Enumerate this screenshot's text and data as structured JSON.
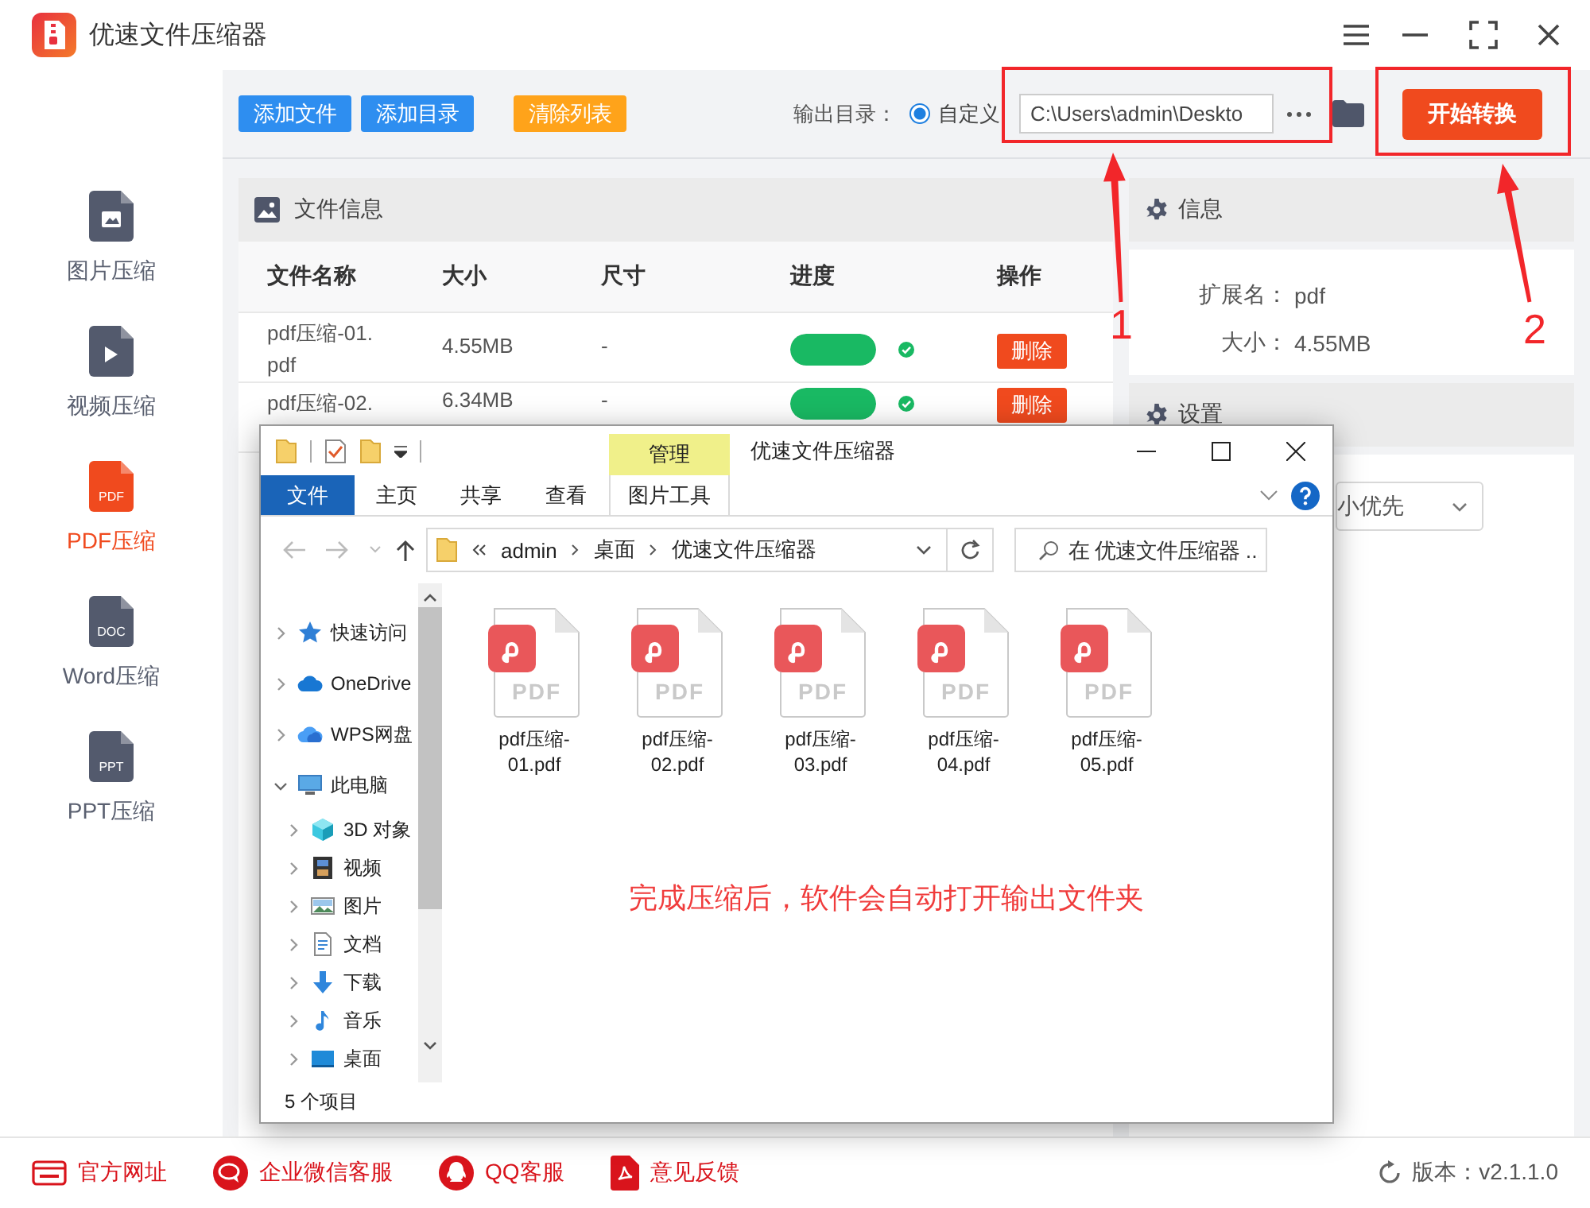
{
  "app": {
    "title": "优速文件压缩器"
  },
  "sidebar": {
    "items": [
      {
        "label": "图片压缩",
        "kind": "image",
        "selected": false
      },
      {
        "label": "视频压缩",
        "kind": "video",
        "selected": false
      },
      {
        "label": "PDF压缩",
        "kind": "badge",
        "icon_text": "PDF",
        "selected": true
      },
      {
        "label": "Word压缩",
        "kind": "badge",
        "icon_text": "DOC",
        "selected": false
      },
      {
        "label": "PPT压缩",
        "kind": "badge",
        "icon_text": "PPT",
        "selected": false
      }
    ]
  },
  "toolbar": {
    "buttons": [
      {
        "label": "添加文件",
        "kind": "primary"
      },
      {
        "label": "添加目录",
        "kind": "primary"
      },
      {
        "label": "清除列表",
        "kind": "warning"
      }
    ],
    "output_label": "输出目录：",
    "radio": {
      "label": "自定义",
      "checked": true
    },
    "path": "C:\\Users\\admin\\Deskto",
    "start": "开始转换"
  },
  "file_panel": {
    "title": "文件信息",
    "columns": [
      "文件名称",
      "大小",
      "尺寸",
      "进度",
      "操作"
    ],
    "rows": [
      {
        "name": "pdf压缩-01.pdf",
        "size": "4.55MB",
        "dims": "-",
        "level": 1,
        "done": true,
        "action": "删除"
      },
      {
        "name": "pdf压缩-02.",
        "size": "6.34MB",
        "dims": "-",
        "level": 1,
        "done": true,
        "action": "删除"
      }
    ]
  },
  "info_panel": {
    "title": "信息",
    "fields": [
      {
        "label": "扩展名：",
        "value": "pdf"
      },
      {
        "label": "大小：",
        "value": "4.55MB"
      }
    ]
  },
  "settings_panel": {
    "title": "设置",
    "select_value": "小优先"
  },
  "footer": {
    "links": [
      {
        "label": "官方网址",
        "kind": "web"
      },
      {
        "label": "企业微信客服",
        "kind": "wechat"
      },
      {
        "label": "QQ客服",
        "kind": "qq"
      },
      {
        "label": "意见反馈",
        "kind": "feedback"
      }
    ],
    "version": "版本：v2.1.1.0"
  },
  "explorer": {
    "title": "优速文件压缩器",
    "context_label": "管理",
    "tabs": [
      {
        "label": "文件",
        "kind": "file"
      },
      {
        "label": "主页",
        "kind": "tab"
      },
      {
        "label": "共享",
        "kind": "tab"
      },
      {
        "label": "查看",
        "kind": "tab"
      },
      {
        "label": "图片工具",
        "kind": "context"
      }
    ],
    "breadcrumb": [
      "admin",
      "桌面",
      "优速文件压缩器"
    ],
    "search": {
      "placeholder": "在 优速文件压缩器 ..."
    },
    "nav_tree": [
      {
        "label": "快速访问",
        "kind": "star",
        "expanded": false
      },
      {
        "label": "OneDrive",
        "kind": "cloud",
        "expanded": false
      },
      {
        "label": "WPS网盘",
        "kind": "wps",
        "expanded": false
      },
      {
        "label": "此电脑",
        "kind": "pc",
        "expanded": true,
        "children": [
          {
            "label": "3D 对象",
            "kind": "cube",
            "expanded": false
          },
          {
            "label": "视频",
            "kind": "film",
            "expanded": false
          },
          {
            "label": "图片",
            "kind": "picture",
            "expanded": false
          },
          {
            "label": "文档",
            "kind": "document",
            "expanded": false
          },
          {
            "label": "下载",
            "kind": "download",
            "expanded": false
          },
          {
            "label": "音乐",
            "kind": "music",
            "expanded": false
          },
          {
            "label": "桌面",
            "kind": "desktop",
            "expanded": false
          }
        ]
      }
    ],
    "files": [
      {
        "name": "pdf压缩-01.pdf",
        "icon_text": "PDF"
      },
      {
        "name": "pdf压缩-02.pdf",
        "icon_text": "PDF"
      },
      {
        "name": "pdf压缩-03.pdf",
        "icon_text": "PDF"
      },
      {
        "name": "pdf压缩-04.pdf",
        "icon_text": "PDF"
      },
      {
        "name": "pdf压缩-05.pdf",
        "icon_text": "PDF"
      }
    ],
    "status": "5 个项目"
  },
  "annotations": {
    "callouts": [
      {
        "label": "1"
      },
      {
        "label": "2"
      }
    ],
    "note": "完成压缩后，软件会自动打开输出文件夹"
  }
}
